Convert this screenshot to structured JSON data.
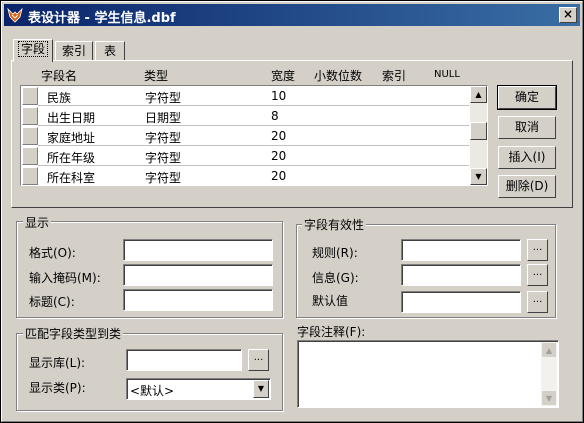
{
  "window": {
    "title": "表设计器 - 学生信息.dbf",
    "close_label": "×"
  },
  "tabs": [
    {
      "label": "字段"
    },
    {
      "label": "索引"
    },
    {
      "label": "表"
    }
  ],
  "grid": {
    "headers": [
      "字段名",
      "类型",
      "宽度",
      "小数位数",
      "索引",
      "NULL"
    ],
    "rows": [
      {
        "name": "民族",
        "type": "字符型",
        "width": "10"
      },
      {
        "name": "出生日期",
        "type": "日期型",
        "width": "8"
      },
      {
        "name": "家庭地址",
        "type": "字符型",
        "width": "20"
      },
      {
        "name": "所在年级",
        "type": "字符型",
        "width": "20"
      },
      {
        "name": "所在科室",
        "type": "字符型",
        "width": "20"
      }
    ]
  },
  "buttons": {
    "ok": "确定",
    "cancel": "取消",
    "insert": "插入(I)",
    "delete": "删除(D)"
  },
  "display_group": {
    "title": "显示",
    "format_label": "格式(O):",
    "mask_label": "输入掩码(M):",
    "caption_label": "标题(C):"
  },
  "validation_group": {
    "title": "字段有效性",
    "rule_label": "规则(R):",
    "message_label": "信息(G):",
    "default_label": "默认值",
    "dots": "..."
  },
  "mapping_group": {
    "title": "匹配字段类型到类",
    "library_label": "显示库(L):",
    "class_label": "显示类(P):",
    "class_value": "<默认>",
    "dots": "..."
  },
  "comment": {
    "label": "字段注释(F):"
  }
}
